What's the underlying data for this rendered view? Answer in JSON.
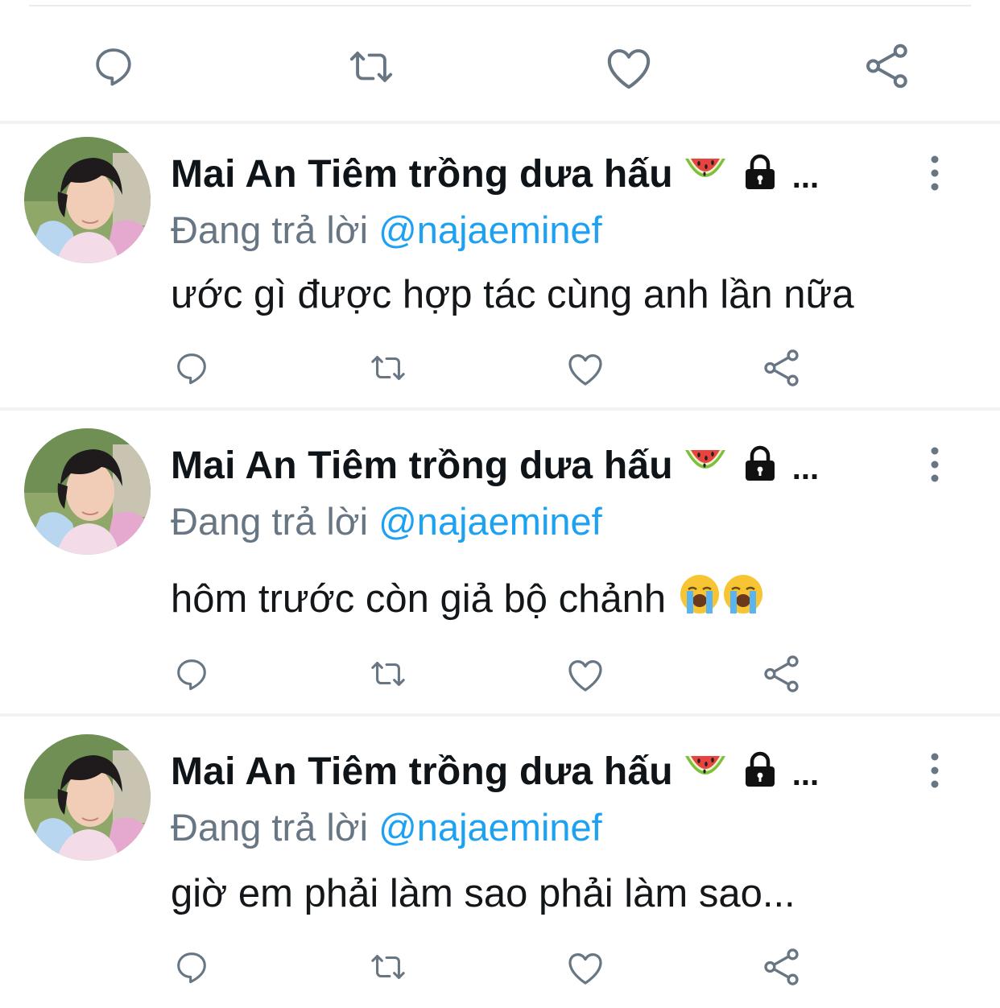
{
  "top_actions": {
    "reply_icon": "reply-icon",
    "retweet_icon": "retweet-icon",
    "like_icon": "heart-icon",
    "share_icon": "share-icon"
  },
  "tweets": [
    {
      "author_name": "Mai An Tiêm trồng dưa hấu",
      "name_emojis": [
        "watermelon-emoji",
        "lock-emoji"
      ],
      "name_truncation": "...",
      "reply_prefix": "Đang trả lời",
      "reply_handle": "@najaeminef",
      "text": "ước gì được hợp tác cùng anh lần nữa",
      "text_emojis": []
    },
    {
      "author_name": "Mai An Tiêm trồng dưa hấu",
      "name_emojis": [
        "watermelon-emoji",
        "lock-emoji"
      ],
      "name_truncation": "...",
      "reply_prefix": "Đang trả lời",
      "reply_handle": "@najaeminef",
      "text": "hôm trước còn giả bộ chảnh",
      "text_emojis": [
        "loudly-crying-face-emoji",
        "loudly-crying-face-emoji"
      ]
    },
    {
      "author_name": "Mai An Tiêm trồng dưa hấu",
      "name_emojis": [
        "watermelon-emoji",
        "lock-emoji"
      ],
      "name_truncation": "...",
      "reply_prefix": "Đang trả lời",
      "reply_handle": "@najaeminef",
      "text": "giờ em phải làm sao phải làm sao...",
      "text_emojis": []
    }
  ],
  "colors": {
    "icon_gray": "#687684",
    "mention_blue": "#1da1f2",
    "divider": "#eff3f5"
  }
}
